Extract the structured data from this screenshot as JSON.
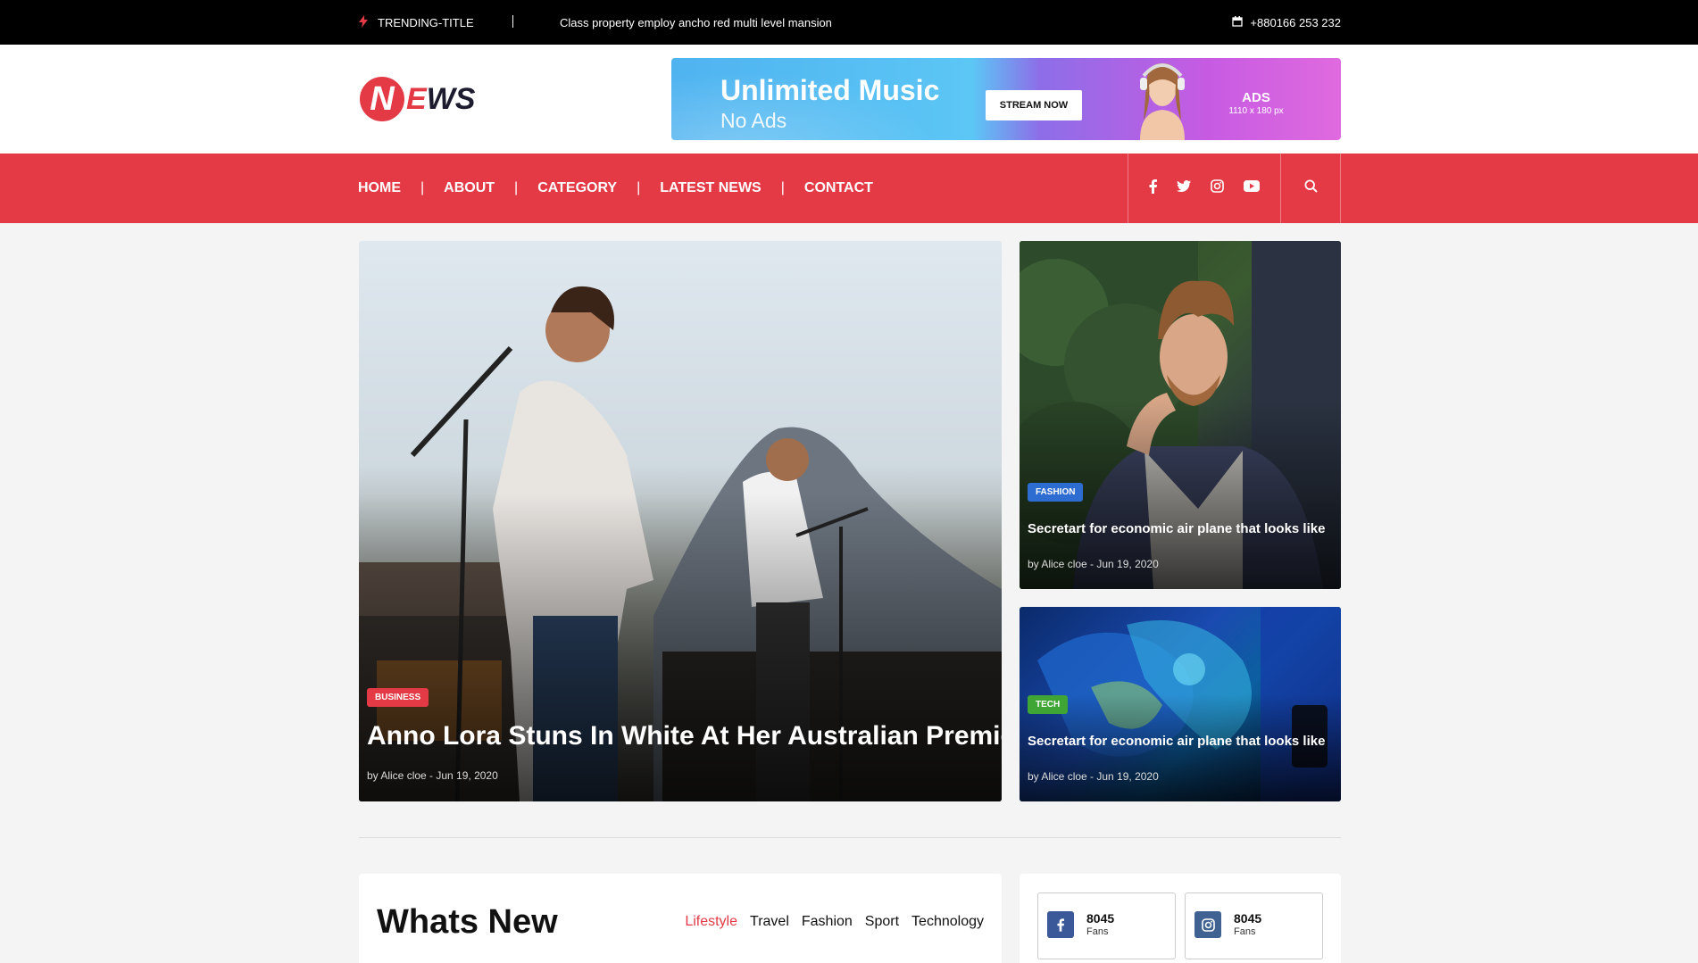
{
  "topbar": {
    "trending_label": "TRENDING-TITLE",
    "headline": "Class property employ ancho red multi level mansion",
    "phone": "+880166 253 232"
  },
  "logo": {
    "n": "N",
    "e": "E",
    "ws": "WS"
  },
  "ad": {
    "title": "Unlimited Music",
    "subtitle": "No Ads",
    "button": "STREAM NOW",
    "ads_label": "ADS",
    "ads_size": "1110 x 180 px"
  },
  "nav": {
    "items": [
      "HOME",
      "ABOUT",
      "CATEGORY",
      "LATEST NEWS",
      "CONTACT"
    ],
    "divider": "|"
  },
  "featured": {
    "category": "BUSINESS",
    "title": "Anno Lora Stuns In White At Her Australian Premiere",
    "meta": "by Alice cloe - Jun 19, 2020"
  },
  "side_posts": [
    {
      "category": "FASHION",
      "title": "Secretart for economic air plane that looks like",
      "meta": "by Alice cloe - Jun 19, 2020"
    },
    {
      "category": "TECH",
      "title": "Secretart for economic air plane that looks like",
      "meta": "by Alice cloe - Jun 19, 2020"
    }
  ],
  "whats_new": {
    "title": "Whats New",
    "tabs": [
      "Lifestyle",
      "Travel",
      "Fashion",
      "Sport",
      "Technology"
    ]
  },
  "fans": [
    {
      "network": "facebook",
      "count": "8045",
      "label": "Fans"
    },
    {
      "network": "instagram",
      "count": "8045",
      "label": "Fans"
    }
  ],
  "colors": {
    "accent": "#e33a45",
    "fashion": "#2d6dd1",
    "tech": "#3fa535",
    "facebook": "#3b5998",
    "instagram": "#3f6293"
  }
}
